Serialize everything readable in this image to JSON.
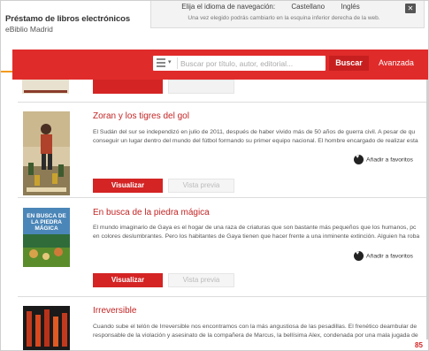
{
  "header": {
    "title": "Préstamo de libros electrónicos",
    "subtitle": "eBiblio Madrid",
    "language": {
      "prompt": "Elija el idioma de navegación:",
      "options": [
        "Castellano",
        "Inglés"
      ],
      "note": "Una vez elegido podrás cambiarlo en la esquina inferior derecha de la web.",
      "close_label": "✕"
    }
  },
  "search": {
    "placeholder": "Buscar por título, autor, editorial...",
    "button_label": "Buscar",
    "advanced_label": "Avanzada",
    "filter_caret": "▾"
  },
  "results": [
    {
      "title": "Zoran y los tigres del gol",
      "desc_lines": [
        "El Sudán del sur se independizó en julio de 2011, después de haber vivido más de 50 años de guerra civil. A pesar de qu",
        "conseguir un lugar dentro del mundo del fútbol formando su primer equipo nacional. El hombre encargado de realizar esta"
      ],
      "favorite_label": "Añadir a favoritos",
      "view_label": "Visualizar",
      "preview_label": "Vista previa"
    },
    {
      "title": "En busca de la piedra mágica",
      "desc_lines": [
        "El mundo imaginario de Gaya es el hogar de una raza de criaturas que son bastante más pequeños que los humanos, pc",
        "en colores deslumbrantes. Pero los habitantes de Gaya tienen que hacer frente a una inminente extinción. Alguien ha roba"
      ],
      "favorite_label": "Añadir a favoritos",
      "view_label": "Visualizar",
      "preview_label": "Vista previa",
      "cover_text": "EN BUSCA DE LA PIEDRA MÁGICA"
    },
    {
      "title": "Irreversible",
      "desc_lines": [
        "Cuando sube el telón de Irreversible nos encontramos con la más angustiosa de las pesadillas. El frenético deambular de",
        "responsable de la violación y asesinato de la compañera de Marcus, la bellísima Alex, condenada por una mala jugada de"
      ]
    }
  ],
  "page_number": "85",
  "colors": {
    "brand_red": "#e02b2b",
    "button_red": "#d42424",
    "link_red": "#c42525"
  }
}
